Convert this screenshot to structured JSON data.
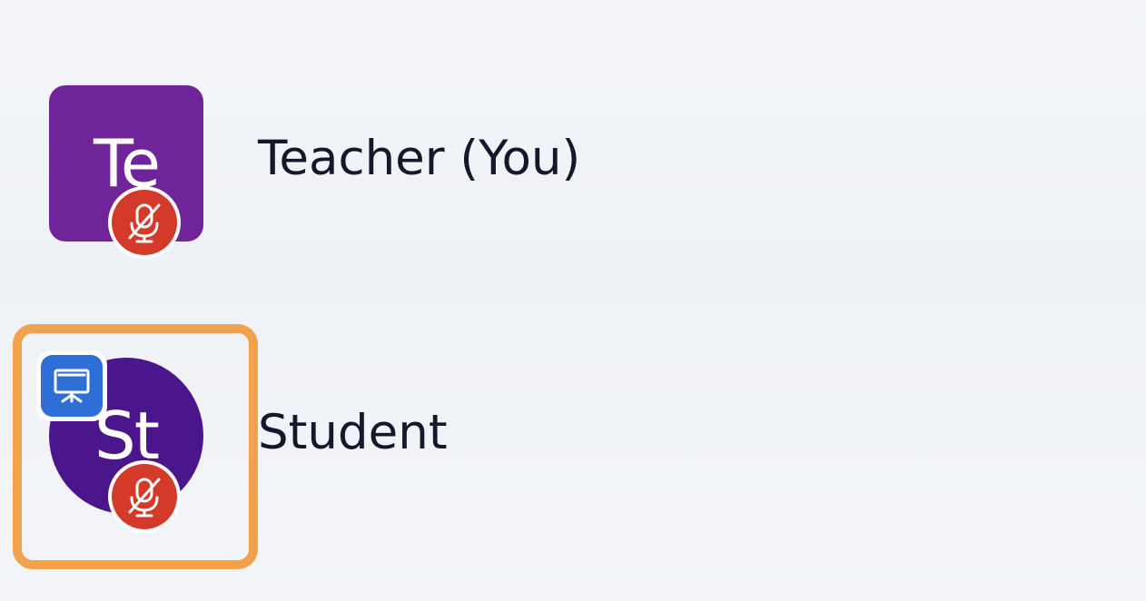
{
  "participants": [
    {
      "initials": "Te",
      "name": "Teacher (You)",
      "avatar_shape": "square",
      "avatar_color": "#70249a",
      "muted": true,
      "status_icon": "mic-off-icon"
    },
    {
      "initials": "St",
      "name": "Student",
      "avatar_shape": "circle",
      "avatar_color": "#4b168c",
      "muted": true,
      "presenting": true,
      "presenter_icon": "presentation-screen-icon",
      "status_icon": "mic-off-icon",
      "focused": true
    }
  ],
  "colors": {
    "mute_badge": "#d43a2a",
    "presenter_badge": "#2d6fd6",
    "focus_ring": "#f0a24e",
    "text": "#13192b",
    "background": "#f2f4f8"
  }
}
